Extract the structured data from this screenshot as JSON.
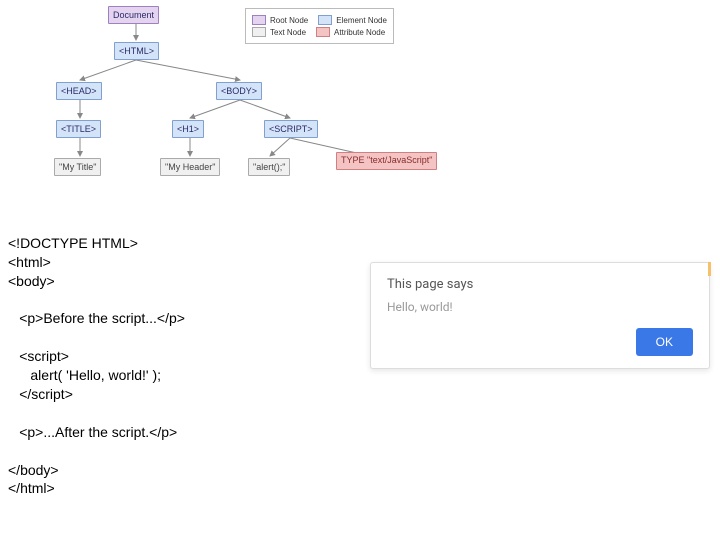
{
  "diagram": {
    "nodes": {
      "document": "Document",
      "html": "<HTML>",
      "head": "<HEAD>",
      "body": "<BODY>",
      "title": "<TITLE>",
      "h1": "<H1>",
      "script": "<SCRIPT>",
      "text_title": "\"My Title\"",
      "text_header": "\"My Header\"",
      "text_alert": "\"alert();\"",
      "attr_type": "TYPE\n\"text/JavaScript\""
    },
    "legend": {
      "root": "Root Node",
      "element": "Element Node",
      "text": "Text Node",
      "attribute": "Attribute Node"
    }
  },
  "code": {
    "l1": "<!DOCTYPE HTML>",
    "l2": "<html>",
    "l3": "<body>",
    "l4": "<p>Before the script...</p>",
    "l5": "<script>",
    "l6": "alert( 'Hello, world!' );",
    "l7": "</script>",
    "l8": "<p>...After the script.</p>",
    "l9": "</body>",
    "l10": "</html>"
  },
  "dialog": {
    "title": "This page says",
    "message": "Hello, world!",
    "ok": "OK"
  }
}
